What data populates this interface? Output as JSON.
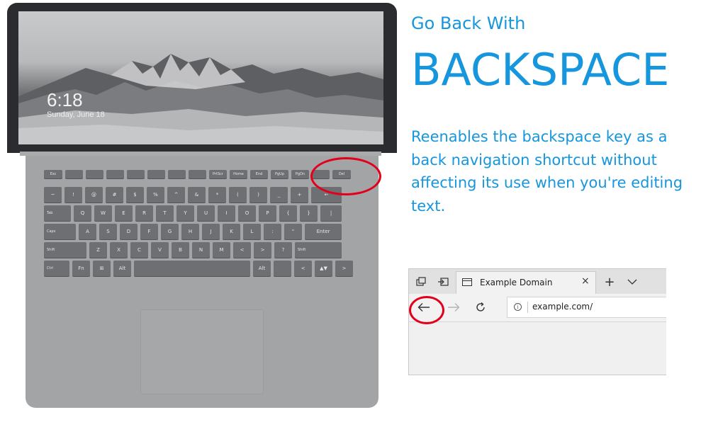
{
  "heading": {
    "subtitle": "Go Back With",
    "title": "BACKSPACE",
    "description": "Reenables the backspace key as a back navigation shortcut without affecting its use when you're editing text."
  },
  "lockscreen": {
    "time": "6:18",
    "date": "Sunday, June 18"
  },
  "keyboard": {
    "fn_row": [
      "Esc",
      "",
      "",
      "",
      "",
      "",
      "",
      "",
      "PrtScr",
      "Home",
      "End",
      "PgUp",
      "PgDn",
      "",
      "Del"
    ],
    "num_row": [
      "~",
      "!",
      "@",
      "#",
      "$",
      "%",
      "^",
      "&",
      "*",
      "(",
      ")",
      "_",
      "+",
      "←"
    ],
    "q_row": [
      "Tab",
      "Q",
      "W",
      "E",
      "R",
      "T",
      "Y",
      "U",
      "I",
      "O",
      "P",
      "{",
      "}",
      "|"
    ],
    "a_row": [
      "Caps",
      "A",
      "S",
      "D",
      "F",
      "G",
      "H",
      "J",
      "K",
      "L",
      ":",
      "\"",
      "Enter"
    ],
    "z_row": [
      "Shift",
      "Z",
      "X",
      "C",
      "V",
      "B",
      "N",
      "M",
      "<",
      ">",
      "?",
      "Shift"
    ],
    "bottom_row": [
      "Ctrl",
      "Fn",
      "⊞",
      "Alt",
      "",
      "Alt",
      "",
      "<",
      "",
      "▲▼",
      ">"
    ]
  },
  "browser": {
    "tab_title": "Example Domain",
    "address": "example.com/",
    "tab_icons": {
      "left1": "tab-preview-icon",
      "left2": "set-aside-tabs-icon",
      "new_tab": "+",
      "dropdown": "⌄",
      "close": "×"
    },
    "nav_icons": {
      "back": "←",
      "forward": "→",
      "refresh": "↻",
      "info": "i"
    }
  },
  "colors": {
    "accent_text": "#1696dd",
    "highlight_ring": "#e3001b"
  }
}
